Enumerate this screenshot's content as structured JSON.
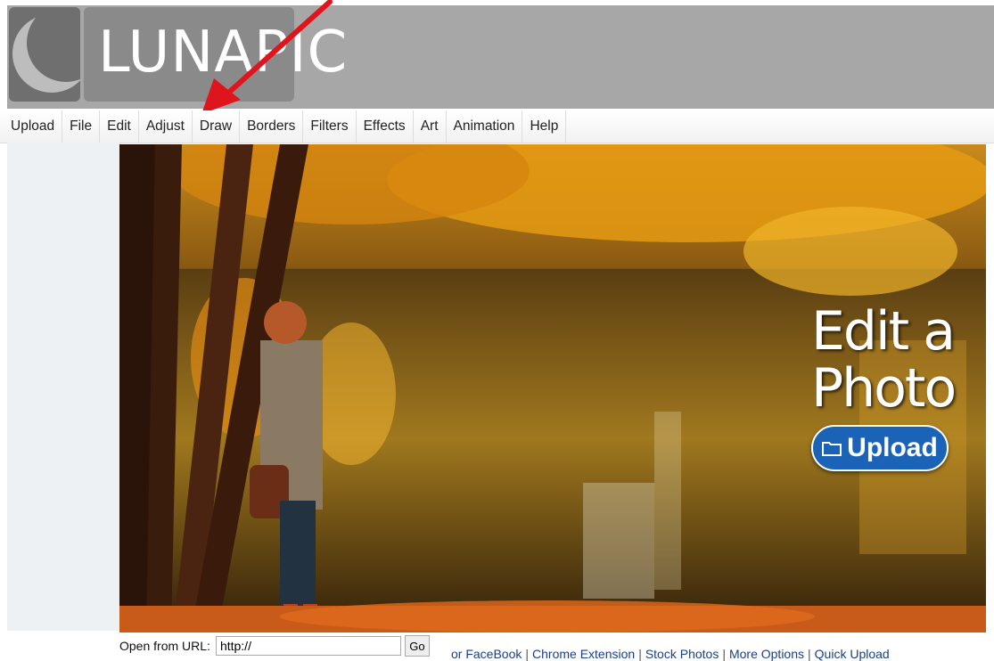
{
  "logo": {
    "text": "LUNAPIC"
  },
  "menu": {
    "items": [
      "Upload",
      "File",
      "Edit",
      "Adjust",
      "Draw",
      "Borders",
      "Filters",
      "Effects",
      "Art",
      "Animation",
      "Help"
    ]
  },
  "hero": {
    "title_line1": "Edit a",
    "title_line2": "Photo",
    "upload_label": "Upload"
  },
  "url_form": {
    "label": "Open from URL:",
    "value": "http://",
    "go_label": "Go"
  },
  "footer_links": [
    "or FaceBook",
    "Chrome Extension",
    "Stock Photos",
    "More Options",
    "Quick Upload"
  ],
  "colors": {
    "header_bg": "#a7a7a7",
    "arrow": "#e0141d",
    "upload_button": "#1a63b6"
  },
  "icons": {
    "annotation": "red-arrow-icon",
    "upload": "folder-icon"
  }
}
